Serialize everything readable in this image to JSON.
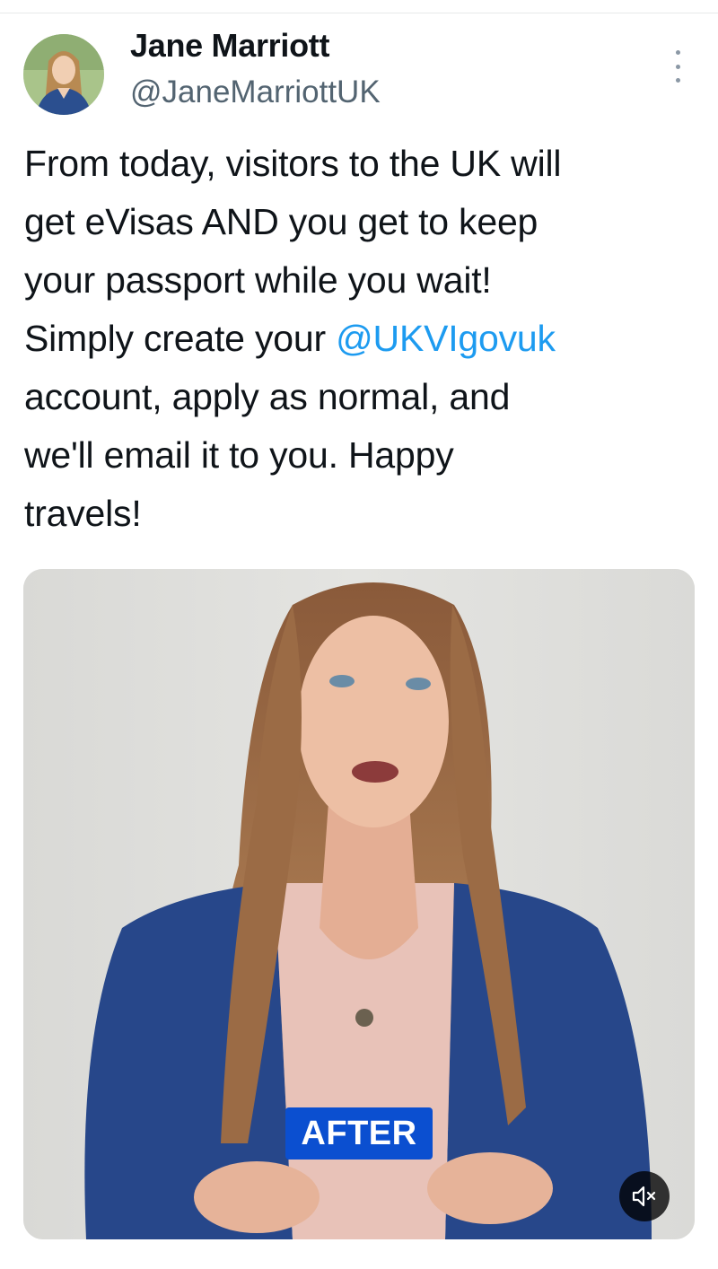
{
  "author": {
    "name": "Jane Marriott",
    "handle": "@JaneMarriottUK"
  },
  "tweet": {
    "line1": "From today, visitors to the UK will",
    "line2": "get eVisas AND you get to keep",
    "line3": "your passport while you wait!",
    "line4_pre": "Simply create your ",
    "mention": "@UKVIgovuk",
    "line5": "account, apply as normal, and",
    "line6": "we'll email it to you. Happy",
    "line7": "travels!"
  },
  "media": {
    "caption": "AFTER"
  },
  "icons": {
    "more": "more-options-icon",
    "mute": "volume-muted-icon"
  },
  "colors": {
    "link": "#1d9bf0",
    "caption_bg": "#0b4fd0",
    "secondary_text": "#536471"
  }
}
